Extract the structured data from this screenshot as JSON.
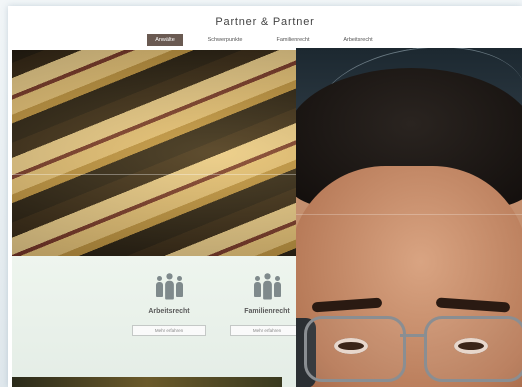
{
  "site": {
    "title": "Partner & Partner",
    "nav": [
      {
        "label": "Anwälte",
        "active": true
      },
      {
        "label": "Schwerpunkte",
        "active": false
      },
      {
        "label": "Familienrecht",
        "active": false
      },
      {
        "label": "Arbeitsrecht",
        "active": false
      }
    ]
  },
  "services": [
    {
      "title": "Arbeitsrecht",
      "button": "Mehr erfahren"
    },
    {
      "title": "Familienrecht",
      "button": "Mehr erfahren"
    }
  ],
  "colors": {
    "nav_active": "#6a5a52",
    "page_bg": "#e4ebef"
  }
}
